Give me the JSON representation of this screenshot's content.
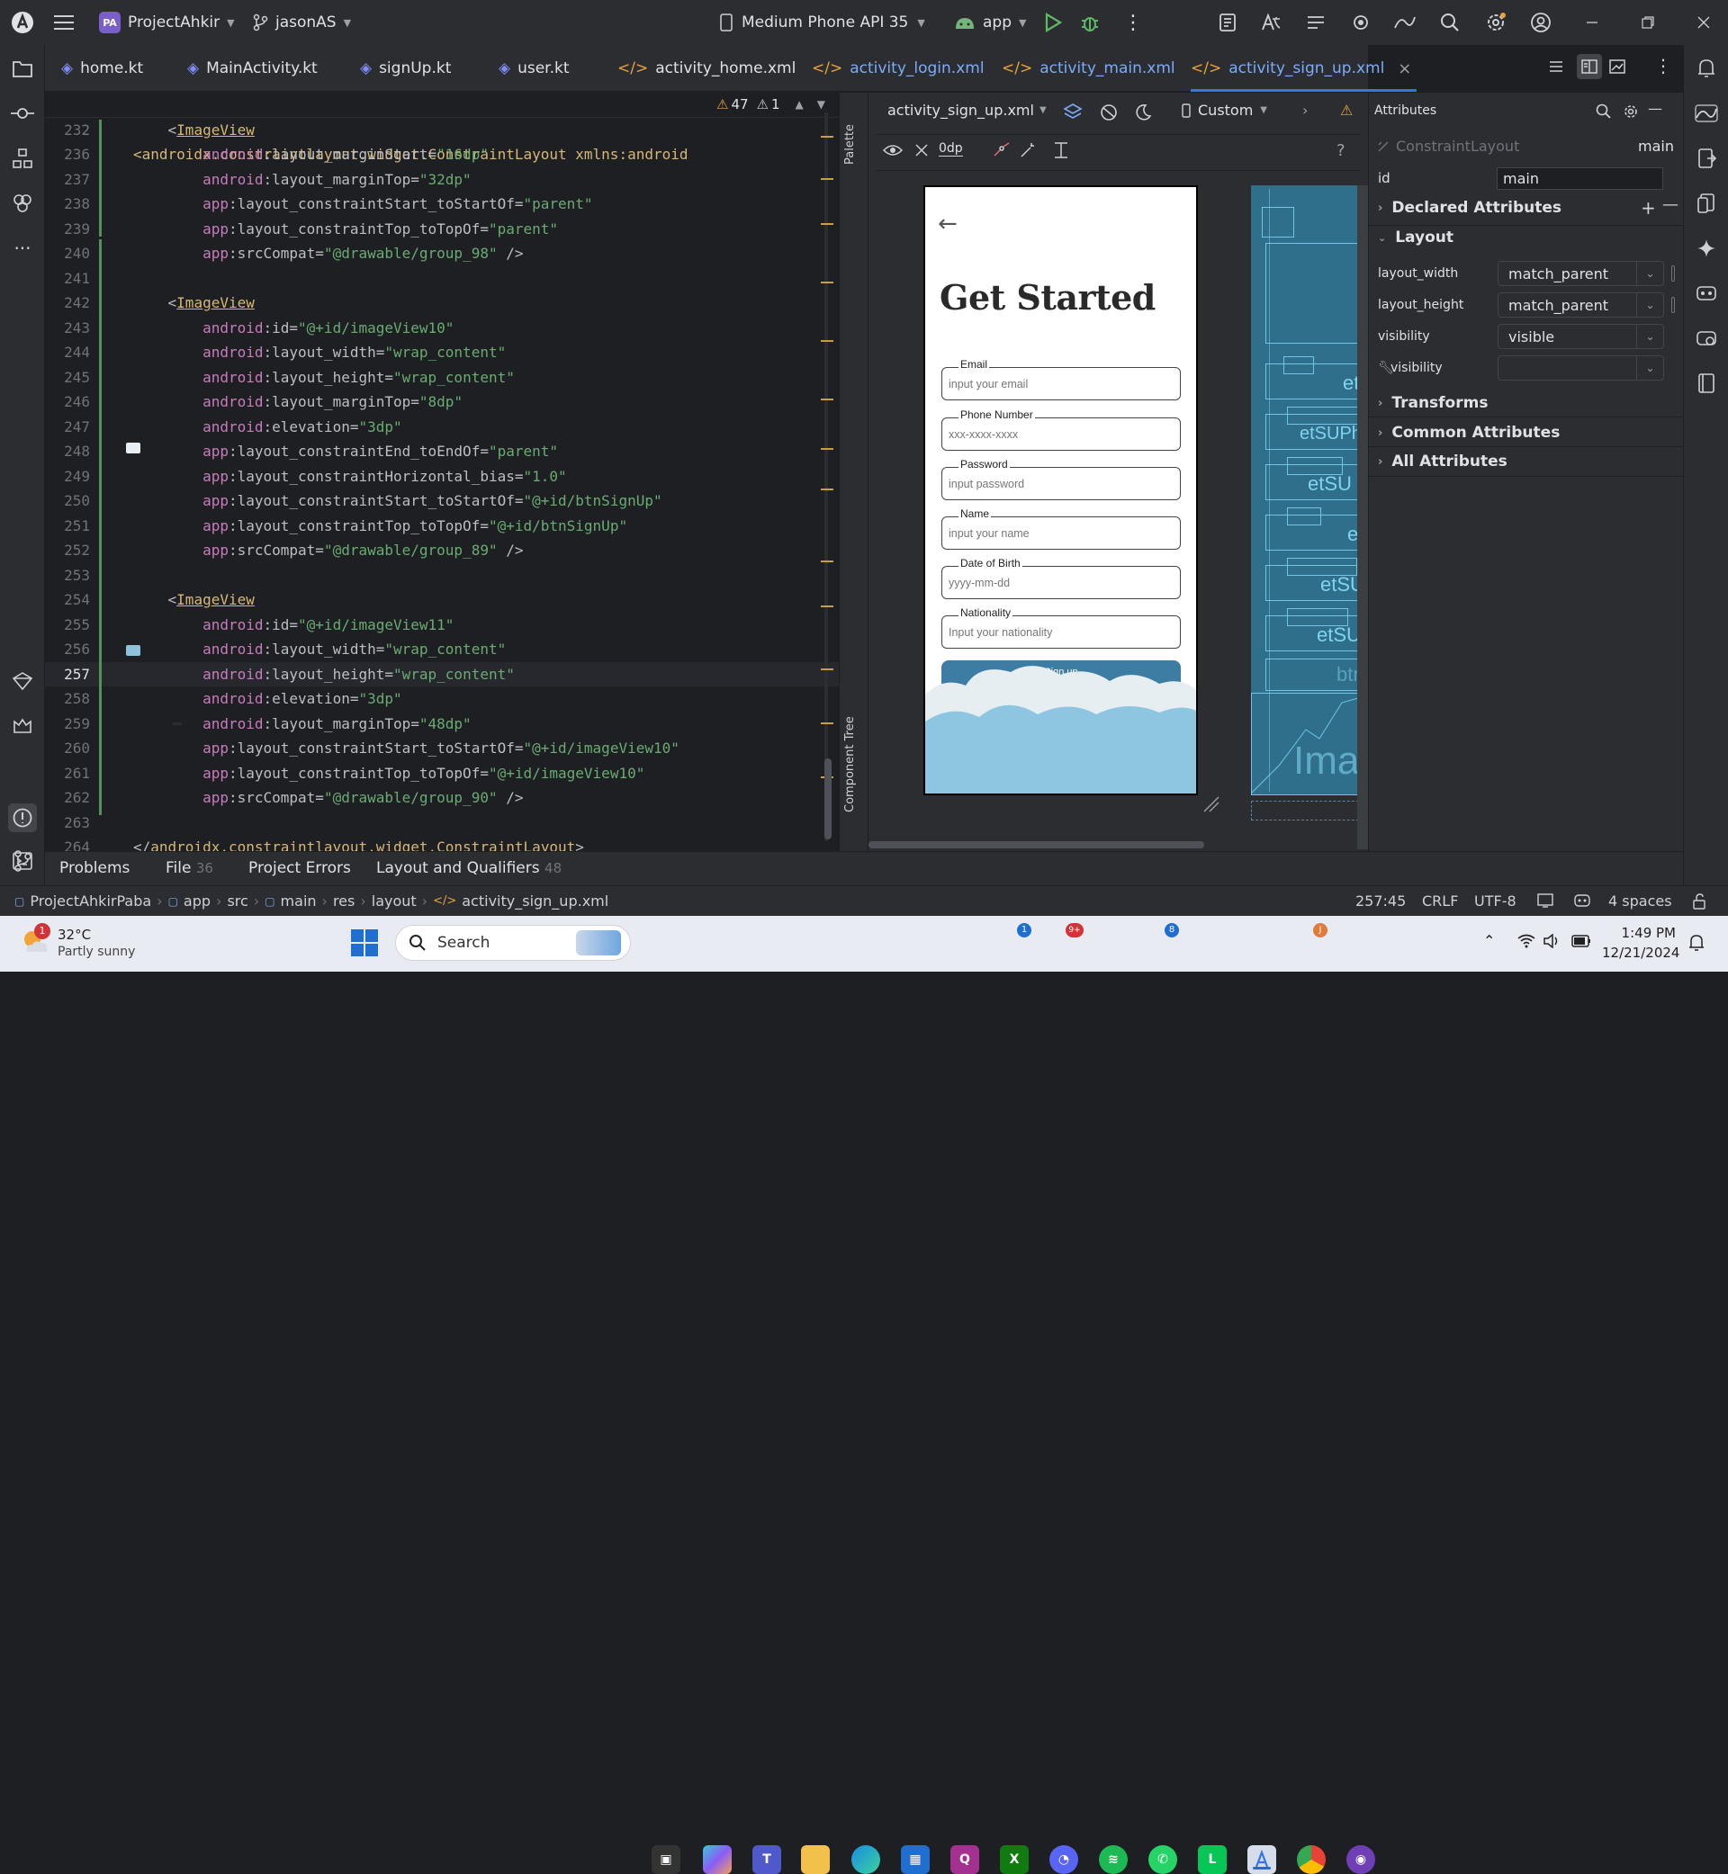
{
  "titlebar": {
    "project_initials": "PA",
    "project_name": "ProjectAhkir",
    "branch": "jasonAS",
    "device": "Medium Phone API 35",
    "run_config": "app"
  },
  "tabs": [
    {
      "label": "home.kt"
    },
    {
      "label": "MainActivity.kt"
    },
    {
      "label": "signUp.kt"
    },
    {
      "label": "user.kt"
    },
    {
      "label": "activity_home.xml"
    },
    {
      "label": "activity_login.xml"
    },
    {
      "label": "activity_main.xml"
    },
    {
      "label": "activity_sign_up.xml"
    }
  ],
  "editor": {
    "sticky_line_no": "2",
    "sticky_text": "<androidx.constraintlayout.widget.ConstraintLayout xmlns:android",
    "warnings": "47",
    "weak_warnings": "1",
    "lines": [
      {
        "no": "232",
        "parts": [
          [
            "pun",
            "    <"
          ],
          [
            "tag",
            "ImageView"
          ]
        ]
      },
      {
        "no": "236",
        "parts": [
          [
            "ns",
            "        android"
          ],
          [
            "attr",
            ":layout_marginStart="
          ],
          [
            "str",
            "\"16dp\""
          ]
        ]
      },
      {
        "no": "237",
        "parts": [
          [
            "ns",
            "        android"
          ],
          [
            "attr",
            ":layout_marginTop="
          ],
          [
            "str",
            "\"32dp\""
          ]
        ]
      },
      {
        "no": "238",
        "parts": [
          [
            "ns",
            "        app"
          ],
          [
            "attr",
            ":layout_constraintStart_toStartOf="
          ],
          [
            "str",
            "\"parent\""
          ]
        ]
      },
      {
        "no": "239",
        "parts": [
          [
            "ns",
            "        app"
          ],
          [
            "attr",
            ":layout_constraintTop_toTopOf="
          ],
          [
            "str",
            "\"parent\""
          ]
        ]
      },
      {
        "no": "240",
        "parts": [
          [
            "ns",
            "        app"
          ],
          [
            "attr",
            ":srcCompat="
          ],
          [
            "str",
            "\"@drawable/group_98\""
          ],
          [
            "pun",
            " />"
          ]
        ]
      },
      {
        "no": "241",
        "parts": []
      },
      {
        "no": "242",
        "parts": [
          [
            "pun",
            "    <"
          ],
          [
            "tag",
            "ImageView"
          ]
        ]
      },
      {
        "no": "243",
        "parts": [
          [
            "ns",
            "        android"
          ],
          [
            "attr",
            ":id="
          ],
          [
            "str",
            "\"@+id/imageView10\""
          ]
        ]
      },
      {
        "no": "244",
        "parts": [
          [
            "ns",
            "        android"
          ],
          [
            "attr",
            ":layout_width="
          ],
          [
            "str",
            "\"wrap_content\""
          ]
        ]
      },
      {
        "no": "245",
        "parts": [
          [
            "ns",
            "        android"
          ],
          [
            "attr",
            ":layout_height="
          ],
          [
            "str",
            "\"wrap_content\""
          ]
        ]
      },
      {
        "no": "246",
        "parts": [
          [
            "ns",
            "        android"
          ],
          [
            "attr",
            ":layout_marginTop="
          ],
          [
            "str",
            "\"8dp\""
          ]
        ]
      },
      {
        "no": "247",
        "parts": [
          [
            "ns",
            "        android"
          ],
          [
            "attr",
            ":elevation="
          ],
          [
            "str",
            "\"3dp\""
          ]
        ]
      },
      {
        "no": "248",
        "parts": [
          [
            "ns",
            "        app"
          ],
          [
            "attr",
            ":layout_constraintEnd_toEndOf="
          ],
          [
            "str",
            "\"parent\""
          ]
        ]
      },
      {
        "no": "249",
        "parts": [
          [
            "ns",
            "        app"
          ],
          [
            "attr",
            ":layout_constraintHorizontal_bias="
          ],
          [
            "str",
            "\"1.0\""
          ]
        ]
      },
      {
        "no": "250",
        "parts": [
          [
            "ns",
            "        app"
          ],
          [
            "attr",
            ":layout_constraintStart_toStartOf="
          ],
          [
            "str",
            "\"@+id/btnSignUp\""
          ]
        ]
      },
      {
        "no": "251",
        "parts": [
          [
            "ns",
            "        app"
          ],
          [
            "attr",
            ":layout_constraintTop_toTopOf="
          ],
          [
            "str",
            "\"@+id/btnSignUp\""
          ]
        ]
      },
      {
        "no": "252",
        "parts": [
          [
            "ns",
            "        app"
          ],
          [
            "attr",
            ":srcCompat="
          ],
          [
            "str",
            "\"@drawable/group_89\""
          ],
          [
            "pun",
            " />"
          ]
        ]
      },
      {
        "no": "253",
        "parts": []
      },
      {
        "no": "254",
        "parts": [
          [
            "pun",
            "    <"
          ],
          [
            "tag",
            "ImageView"
          ]
        ]
      },
      {
        "no": "255",
        "parts": [
          [
            "ns",
            "        android"
          ],
          [
            "attr",
            ":id="
          ],
          [
            "str",
            "\"@+id/imageView11\""
          ]
        ]
      },
      {
        "no": "256",
        "parts": [
          [
            "ns",
            "        android"
          ],
          [
            "attr",
            ":layout_width="
          ],
          [
            "str",
            "\"wrap_content\""
          ]
        ]
      },
      {
        "no": "257",
        "parts": [
          [
            "ns",
            "        android"
          ],
          [
            "attr",
            ":layout_height="
          ],
          [
            "str",
            "\"wrap_content\""
          ]
        ]
      },
      {
        "no": "258",
        "parts": [
          [
            "ns",
            "        android"
          ],
          [
            "attr",
            ":elevation="
          ],
          [
            "str",
            "\"3dp\""
          ]
        ]
      },
      {
        "no": "259",
        "parts": [
          [
            "ns",
            "        android"
          ],
          [
            "attr",
            ":layout_marginTop="
          ],
          [
            "str",
            "\"48dp\""
          ]
        ]
      },
      {
        "no": "260",
        "parts": [
          [
            "ns",
            "        app"
          ],
          [
            "attr",
            ":layout_constraintStart_toStartOf="
          ],
          [
            "str",
            "\"@+id/imageView10\""
          ]
        ]
      },
      {
        "no": "261",
        "parts": [
          [
            "ns",
            "        app"
          ],
          [
            "attr",
            ":layout_constraintTop_toTopOf="
          ],
          [
            "str",
            "\"@+id/imageView10\""
          ]
        ]
      },
      {
        "no": "262",
        "parts": [
          [
            "ns",
            "        app"
          ],
          [
            "attr",
            ":srcCompat="
          ],
          [
            "str",
            "\"@drawable/group_90\""
          ],
          [
            "pun",
            " />"
          ]
        ]
      },
      {
        "no": "263",
        "parts": []
      },
      {
        "no": "264",
        "parts": [
          [
            "pun",
            "</"
          ],
          [
            "tag",
            "androidx.constraintlayout.widget.ConstraintLayout"
          ],
          [
            "pun",
            ">"
          ]
        ]
      }
    ]
  },
  "preview": {
    "file": "activity_sign_up.xml",
    "device": "Custom",
    "margin": "0dp",
    "palette_label": "Palette",
    "tree_label": "Component Tree",
    "phone": {
      "title": "Get Started",
      "fields": [
        {
          "label": "Email",
          "placeholder": "input your email"
        },
        {
          "label": "Phone Number",
          "placeholder": "xxx-xxxx-xxxx"
        },
        {
          "label": "Password",
          "placeholder": "input password"
        },
        {
          "label": "Name",
          "placeholder": "input your name"
        },
        {
          "label": "Date of Birth",
          "placeholder": "yyyy-mm-dd"
        },
        {
          "label": "Nationality",
          "placeholder": "Input your nationality"
        }
      ],
      "button": "Sign up"
    },
    "blueprint_labels": [
      "etS",
      "etSUPh",
      "etSU",
      "etS",
      "etSU",
      "etSUN",
      "btn",
      "Imag"
    ]
  },
  "attributes": {
    "title": "Attributes",
    "component": "ConstraintLayout",
    "component_id": "main",
    "id_label": "id",
    "id_value": "main",
    "sections": {
      "declared": "Declared Attributes",
      "layout": "Layout",
      "transforms": "Transforms",
      "common": "Common Attributes",
      "all": "All Attributes"
    },
    "rows": [
      {
        "label": "layout_width",
        "value": "match_parent"
      },
      {
        "label": "layout_height",
        "value": "match_parent"
      },
      {
        "label": "visibility",
        "value": "visible"
      },
      {
        "label": "visibility",
        "value": ""
      }
    ]
  },
  "bottom_tabs": [
    {
      "label": "Problems",
      "count": ""
    },
    {
      "label": "File",
      "count": "36"
    },
    {
      "label": "Project Errors",
      "count": ""
    },
    {
      "label": "Layout and Qualifiers",
      "count": "48"
    }
  ],
  "statusbar": {
    "breadcrumb": [
      "ProjectAhkirPaba",
      "app",
      "src",
      "main",
      "res",
      "layout",
      "activity_sign_up.xml"
    ],
    "position": "257:45",
    "line_sep": "CRLF",
    "encoding": "UTF-8",
    "indent": "4 spaces"
  },
  "taskbar": {
    "weather_temp": "32°C",
    "weather_desc": "Partly sunny",
    "weather_badge": "1",
    "search_placeholder": "Search",
    "time": "1:49 PM",
    "date": "12/21/2024",
    "teams_badge": "1",
    "discord_badge": "9+",
    "whatsapp_badge": "8",
    "chrome_badge": "J"
  },
  "colors": {
    "accent": "#3574f0",
    "active_tab_text": "#7cacf8",
    "string": "#6aab73",
    "namespace": "#c77dbb",
    "tag": "#d5b778",
    "blueprint": "#2f6f8b"
  }
}
